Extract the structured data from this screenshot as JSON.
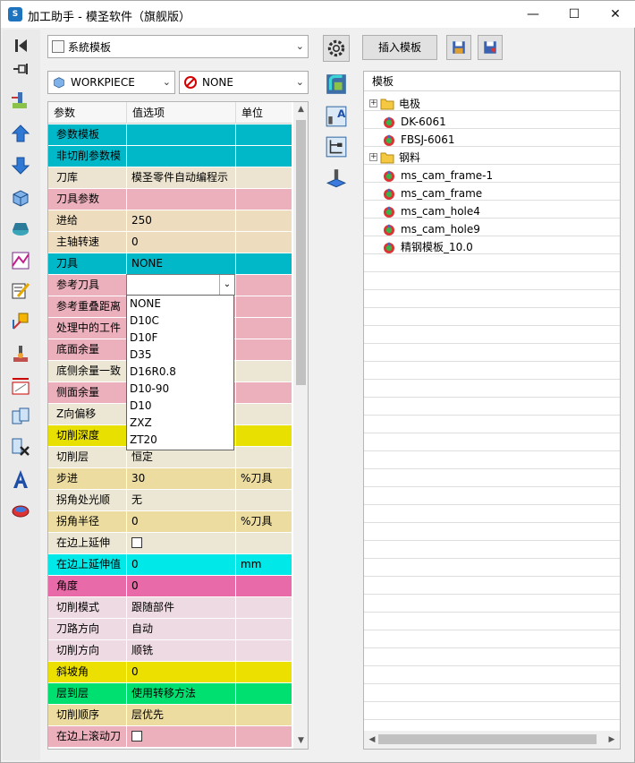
{
  "window": {
    "title": "加工助手 - 模圣软件（旗舰版）",
    "logo_text": "S",
    "minimize_glyph": "—",
    "maximize_glyph": "☐",
    "close_glyph": "✕"
  },
  "left_toolbar": {
    "icons": [
      "first-page-icon",
      "pin-icon",
      "operation-tool-icon",
      "move-up-icon",
      "move-down-icon",
      "cube-icon",
      "solid-icon",
      "toolpath-icon",
      "edit-icon",
      "transform-icon",
      "simulate-icon",
      "measure-icon",
      "copy-icon",
      "delete-icon",
      "text-icon",
      "export-icon"
    ]
  },
  "template_combo": {
    "value": "系統模板",
    "icon": "template-icon"
  },
  "workpiece_combo": {
    "value": "WORKPIECE",
    "icon": "workpiece-icon"
  },
  "geometry_combo": {
    "value": "NONE",
    "icon": "none-icon"
  },
  "grid": {
    "headers": [
      "参数",
      "值选项",
      "单位"
    ],
    "rows": [
      {
        "p": "参数模板",
        "v": "",
        "u": "",
        "color": "#00b8c8"
      },
      {
        "p": "非切削参数模",
        "v": "",
        "u": "",
        "color": "#00b8c8"
      },
      {
        "p": "刀库",
        "v": "模圣零件自动编程示",
        "u": "",
        "color": "#ece4d0"
      },
      {
        "p": "刀具参数",
        "v": "",
        "u": "",
        "color": "#ecb0bc"
      },
      {
        "p": "进给",
        "v": "250",
        "u": "",
        "color": "#eddcbe"
      },
      {
        "p": "主轴转速",
        "v": "0",
        "u": "",
        "color": "#eddcbe"
      },
      {
        "p": "刀具",
        "v": "NONE",
        "u": "",
        "color": "#00b8c8"
      },
      {
        "p": "参考刀具",
        "v": "",
        "u": "",
        "color": "#ecb0bc"
      },
      {
        "p": "参考重叠距离",
        "v": "",
        "u": "",
        "color": "#ecb0bc"
      },
      {
        "p": "处理中的工件",
        "v": "",
        "u": "",
        "color": "#ecb0bc"
      },
      {
        "p": "底面余量",
        "v": "",
        "u": "",
        "color": "#ecb0bc"
      },
      {
        "p": "底侧余量一致",
        "v": "",
        "u": "",
        "color": "#ece6d4"
      },
      {
        "p": "侧面余量",
        "v": "",
        "u": "",
        "color": "#ecb0bc"
      },
      {
        "p": "Z向偏移",
        "v": "",
        "u": "",
        "color": "#ece6d4"
      },
      {
        "p": "切削深度",
        "v": "",
        "u": "",
        "color": "#e8e000"
      },
      {
        "p": "切削层",
        "v": "恒定",
        "u": "",
        "color": "#ece6d4"
      },
      {
        "p": "步进",
        "v": "30",
        "u": "%刀具",
        "color": "#ecdca0"
      },
      {
        "p": "拐角处光顺",
        "v": "无",
        "u": "",
        "color": "#ece6d4"
      },
      {
        "p": "拐角半径",
        "v": "0",
        "u": "%刀具",
        "color": "#ecdca0"
      },
      {
        "p": "在边上延伸",
        "v": "",
        "u": "",
        "color": "#ece6d4",
        "checkbox": true
      },
      {
        "p": "在边上延伸值",
        "v": "0",
        "u": "mm",
        "color": "#00e8e8"
      },
      {
        "p": "角度",
        "v": "0",
        "u": "",
        "color": "#e86aa8"
      },
      {
        "p": "切削模式",
        "v": "跟随部件",
        "u": "",
        "color": "#eedae2"
      },
      {
        "p": "刀路方向",
        "v": "自动",
        "u": "",
        "color": "#eedae2"
      },
      {
        "p": "切削方向",
        "v": "顺铣",
        "u": "",
        "color": "#eedae2"
      },
      {
        "p": "斜坡角",
        "v": "0",
        "u": "",
        "color": "#ece000"
      },
      {
        "p": "层到层",
        "v": "使用转移方法",
        "u": "",
        "color": "#00e070"
      },
      {
        "p": "切削顺序",
        "v": "层优先",
        "u": "",
        "color": "#ecdca0"
      },
      {
        "p": "在边上滚动刀",
        "v": "",
        "u": "",
        "color": "#ecb0bc",
        "checkbox": true
      }
    ]
  },
  "tool_dropdown": {
    "value": "",
    "options": [
      "NONE",
      "D10C",
      "D10F",
      "D35",
      "D16R0.8",
      "D10-90",
      "D10",
      "ZXZ",
      "ZT20"
    ]
  },
  "mid_toolbar": {
    "icons": [
      "settings-gear-icon",
      "machine-view-icon",
      "tool-text-icon",
      "geometry-tree-icon",
      "machine-axis-icon"
    ]
  },
  "template_panel": {
    "insert_button": "插入模板",
    "save_icon": "save-icon",
    "save_as_icon": "save-as-icon",
    "tree_header": "模板",
    "nodes": [
      {
        "label": "电极",
        "type": "folder",
        "level": 0
      },
      {
        "label": "DK-6061",
        "type": "template",
        "level": 1
      },
      {
        "label": "FBSJ-6061",
        "type": "template",
        "level": 1
      },
      {
        "label": "钢料",
        "type": "folder",
        "level": 0
      },
      {
        "label": "ms_cam_frame-1",
        "type": "template",
        "level": 1
      },
      {
        "label": "ms_cam_frame",
        "type": "template",
        "level": 1
      },
      {
        "label": "ms_cam_hole4",
        "type": "template",
        "level": 1
      },
      {
        "label": "ms_cam_hole9",
        "type": "template",
        "level": 1
      },
      {
        "label": "精钢模板_10.0",
        "type": "template",
        "level": 1
      }
    ]
  },
  "scroll": {
    "up": "▲",
    "down": "▼",
    "left": "◀",
    "right": "▶"
  }
}
